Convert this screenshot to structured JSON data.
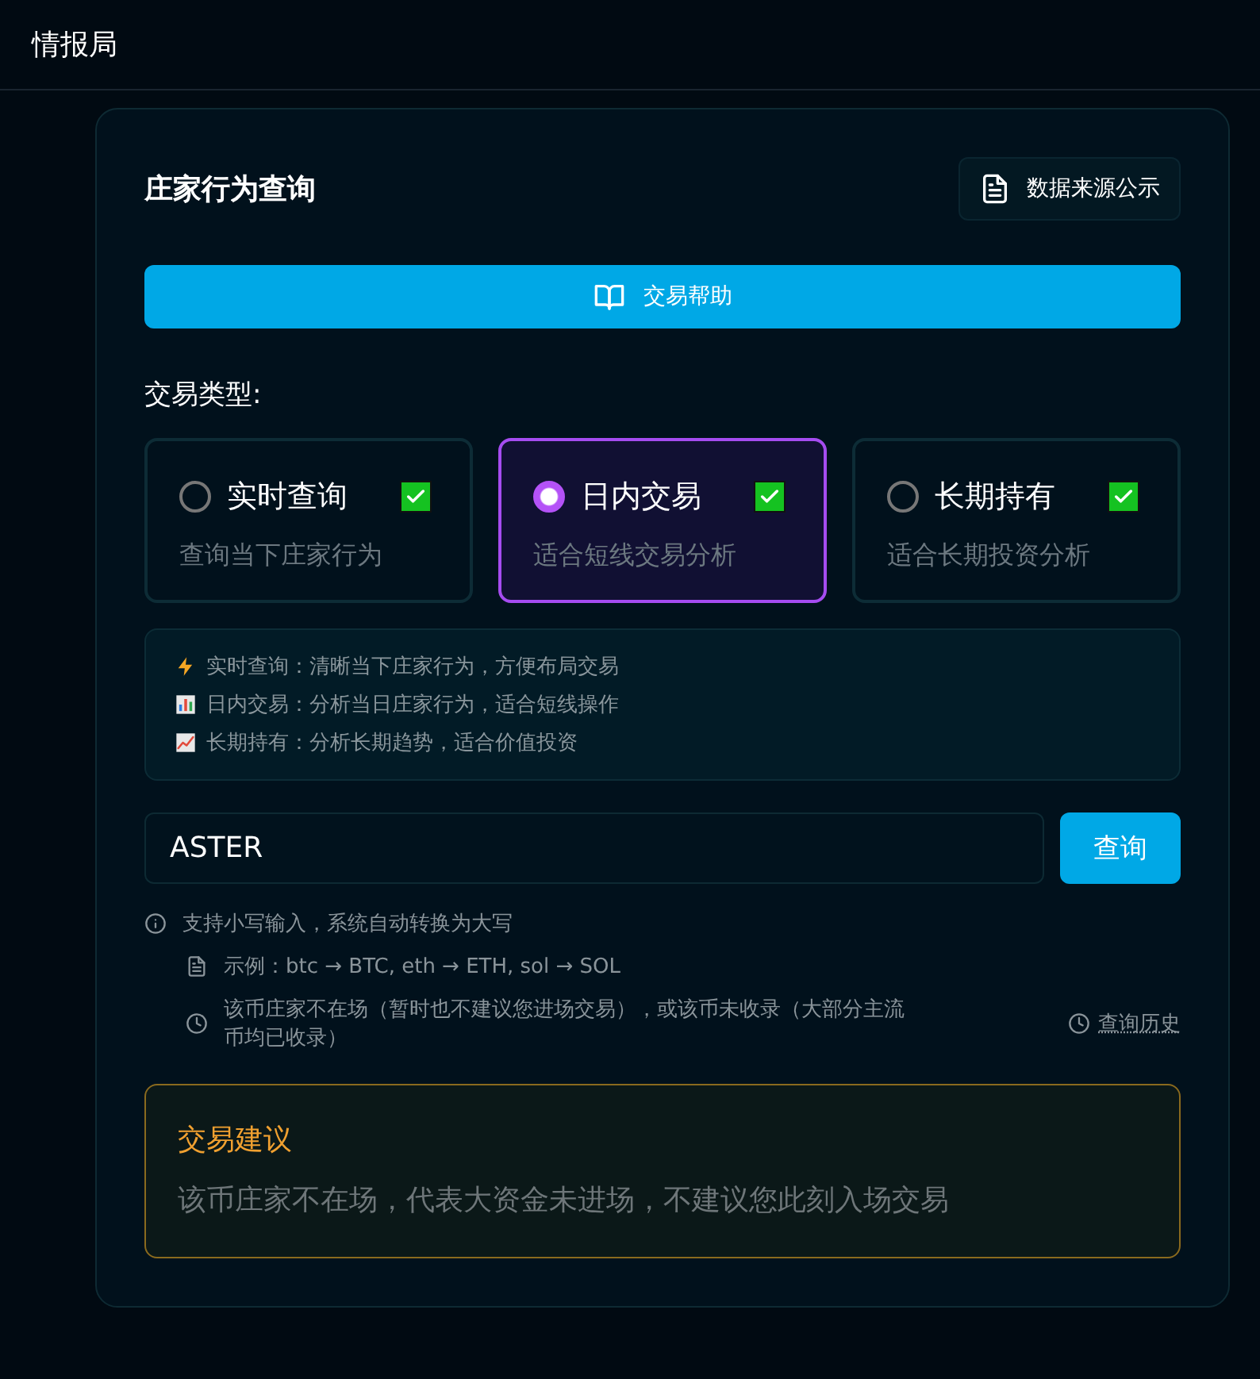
{
  "header": {
    "title": "情报局"
  },
  "card": {
    "title": "庄家行为查询",
    "source_button": "数据来源公示",
    "help_button": "交易帮助",
    "type_label": "交易类型:",
    "options": [
      {
        "label": "实时查询",
        "description": "查询当下庄家行为",
        "selected": false,
        "checked": true
      },
      {
        "label": "日内交易",
        "description": "适合短线交易分析",
        "selected": true,
        "checked": true
      },
      {
        "label": "长期持有",
        "description": "适合长期投资分析",
        "selected": false,
        "checked": true
      }
    ],
    "notes": [
      {
        "kind": "bolt",
        "text": "实时查询：清晰当下庄家行为，方便布局交易"
      },
      {
        "kind": "bars",
        "text": "日内交易：分析当日庄家行为，适合短线操作"
      },
      {
        "kind": "trend",
        "text": "长期持有：分析长期趋势，适合价值投资"
      }
    ],
    "search": {
      "value": "ASTER",
      "button": "查询"
    },
    "hints": [
      {
        "kind": "info",
        "text": "支持小写输入，系统自动转换为大写"
      },
      {
        "kind": "doc",
        "text": "示例：btc → BTC, eth → ETH, sol → SOL"
      },
      {
        "kind": "clock",
        "text": "该币庄家不在场（暂时也不建议您进场交易），或该币未收录（大部分主流币均已收录）"
      }
    ],
    "history_link": "查询历史",
    "advice": {
      "title": "交易建议",
      "text": "该币庄家不在场，代表大资金未进场，不建议您此刻入场交易"
    }
  }
}
